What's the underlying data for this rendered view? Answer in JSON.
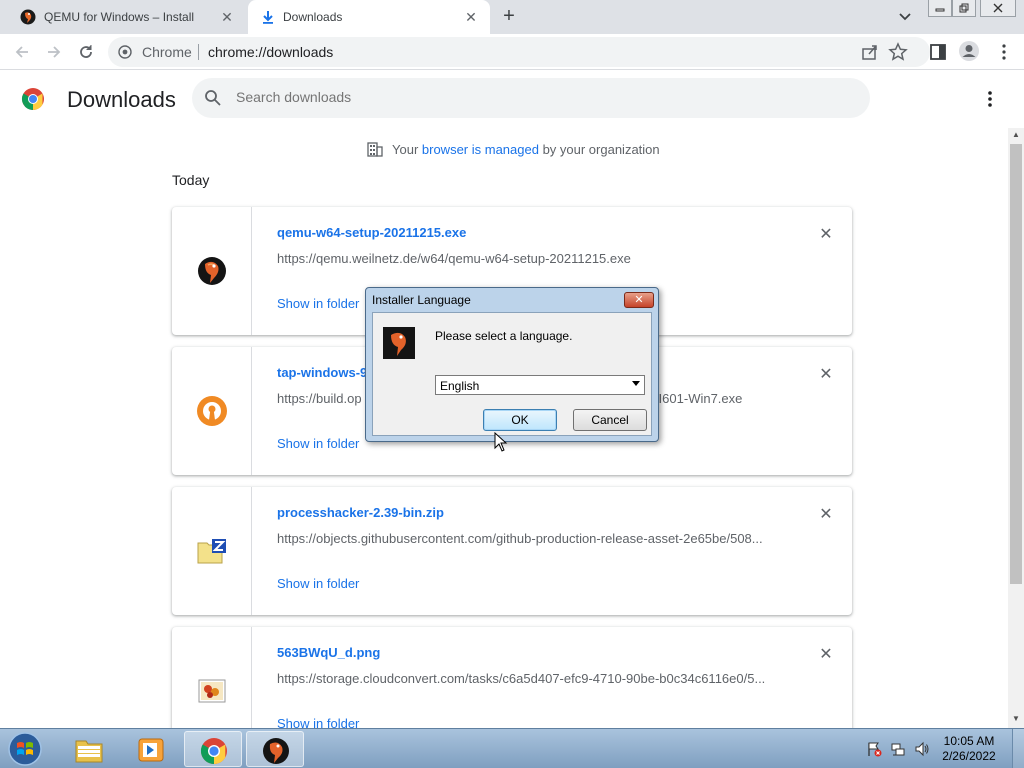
{
  "browser": {
    "tabs": [
      {
        "title": "QEMU for Windows – Installers (",
        "active": false
      },
      {
        "title": "Downloads",
        "active": true
      }
    ],
    "omnibox": {
      "scheme_label": "Chrome",
      "url": "chrome://downloads"
    }
  },
  "downloads_page": {
    "title": "Downloads",
    "search_placeholder": "Search downloads",
    "managed": {
      "prefix": "Your ",
      "link": "browser is managed",
      "suffix": " by your organization"
    },
    "section_label": "Today",
    "items": [
      {
        "filename": "qemu-w64-setup-20211215.exe",
        "url": "https://qemu.weilnetz.de/w64/qemu-w64-setup-20211215.exe",
        "action": "Show in folder",
        "icon": "qemu-icon"
      },
      {
        "filename": "tap-windows-9.",
        "url": "https://build.op",
        "url_tail": "2-I601-Win7.exe",
        "action": "Show in folder",
        "icon": "openvpn-icon"
      },
      {
        "filename": "processhacker-2.39-bin.zip",
        "url": "https://objects.githubusercontent.com/github-production-release-asset-2e65be/508...",
        "action": "Show in folder",
        "icon": "zip-folder-icon"
      },
      {
        "filename": "563BWqU_d.png",
        "url": "https://storage.cloudconvert.com/tasks/c6a5d407-efc9-4710-90be-b0c34c6116e0/5...",
        "action": "Show in folder",
        "icon": "image-file-icon"
      }
    ]
  },
  "dialog": {
    "title": "Installer Language",
    "message": "Please select a language.",
    "selected_language": "English",
    "ok_label": "OK",
    "cancel_label": "Cancel",
    "close_glyph": "✕"
  },
  "taskbar": {
    "apps": [
      "explorer-icon",
      "media-player-icon",
      "chrome-icon",
      "qemu-icon"
    ],
    "clock_time": "10:05 AM",
    "clock_date": "2/26/2022"
  },
  "colors": {
    "link_blue": "#1a73e8",
    "tabstrip": "#dee1e6",
    "dialog_frame": "#bcd3ea",
    "taskbar": "#8fb0d0"
  }
}
